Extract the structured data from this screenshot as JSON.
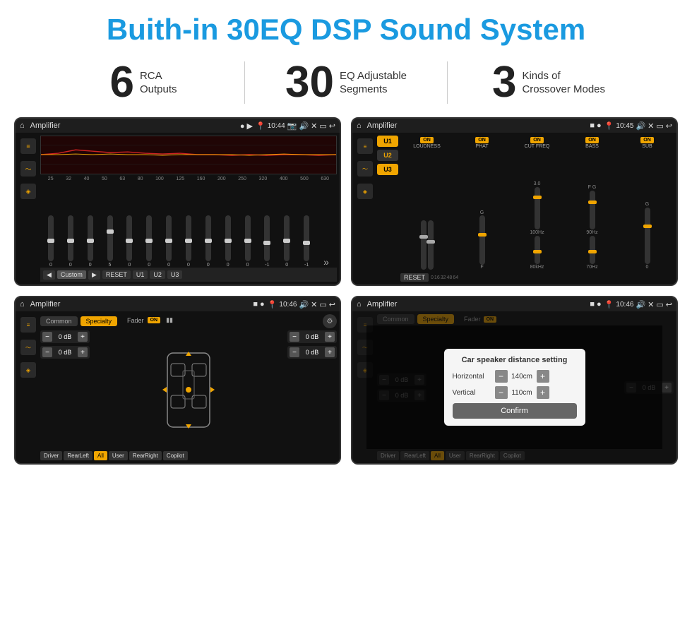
{
  "page": {
    "title": "Buith-in 30EQ DSP Sound System"
  },
  "stats": [
    {
      "number": "6",
      "label": "RCA\nOutputs"
    },
    {
      "number": "30",
      "label": "EQ Adjustable\nSegments"
    },
    {
      "number": "3",
      "label": "Kinds of\nCrossover Modes"
    }
  ],
  "screens": {
    "eq": {
      "title": "Amplifier",
      "time": "10:44",
      "frequencies": [
        "25",
        "32",
        "40",
        "50",
        "63",
        "80",
        "100",
        "125",
        "160",
        "200",
        "250",
        "320",
        "400",
        "500",
        "630"
      ],
      "values": [
        "0",
        "0",
        "0",
        "5",
        "0",
        "0",
        "0",
        "0",
        "0",
        "0",
        "0",
        "-1",
        "0",
        "-1"
      ],
      "mode": "Custom",
      "presets": [
        "RESET",
        "U1",
        "U2",
        "U3"
      ]
    },
    "crossover": {
      "title": "Amplifier",
      "time": "10:45",
      "presets": [
        "U1",
        "U2",
        "U3"
      ],
      "controls": [
        "LOUDNESS",
        "PHAT",
        "CUT FREQ",
        "BASS",
        "SUB"
      ],
      "resetLabel": "RESET"
    },
    "speaker": {
      "title": "Amplifier",
      "time": "10:46",
      "tabs": [
        "Common",
        "Specialty"
      ],
      "faderLabel": "Fader",
      "faderOn": "ON",
      "volumes": [
        "0 dB",
        "0 dB",
        "0 dB",
        "0 dB"
      ],
      "buttons": [
        "Driver",
        "All",
        "User",
        "RearLeft",
        "RearRight",
        "Copilot"
      ]
    },
    "dialog": {
      "title": "Amplifier",
      "time": "10:46",
      "tabs": [
        "Common",
        "Specialty"
      ],
      "dialogTitle": "Car speaker distance setting",
      "horizontalLabel": "Horizontal",
      "horizontalValue": "140cm",
      "verticalLabel": "Vertical",
      "verticalValue": "110cm",
      "confirmLabel": "Confirm",
      "dBValues": [
        "0 dB",
        "0 dB"
      ],
      "buttons": [
        "Driver",
        "RearLeft",
        "User",
        "RearRight",
        "Copilot"
      ]
    }
  }
}
